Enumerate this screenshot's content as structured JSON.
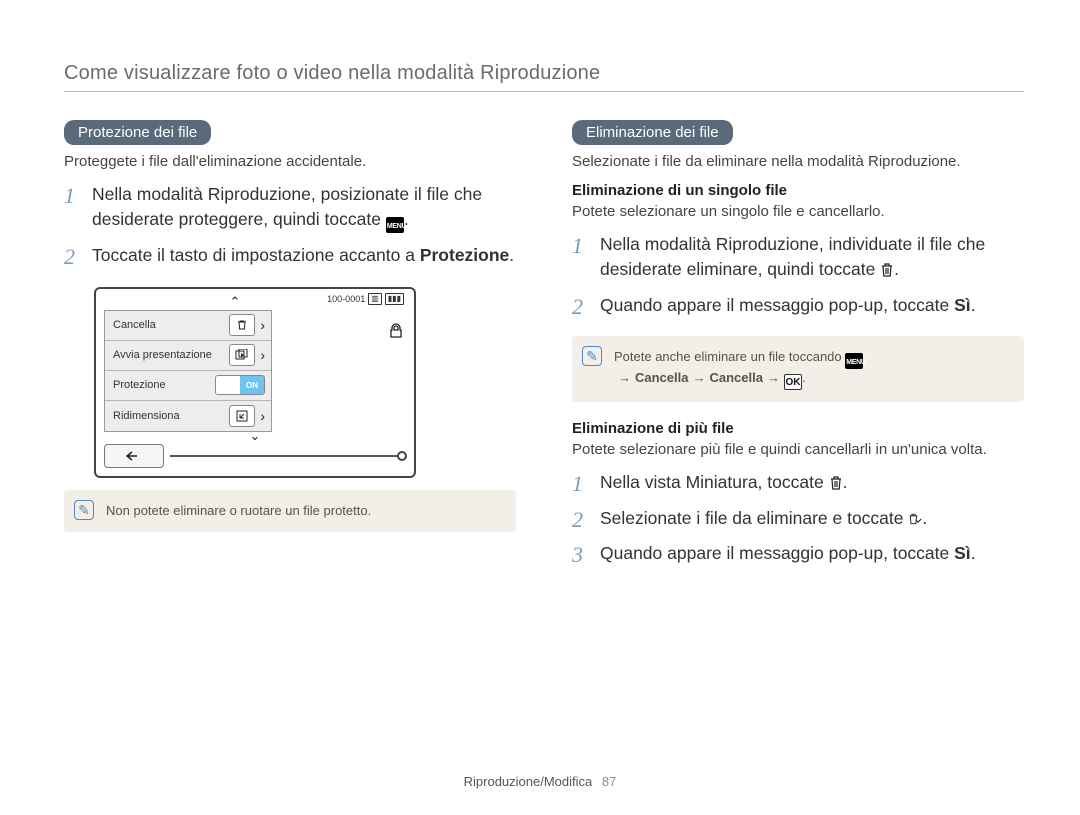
{
  "page_title": "Come visualizzare foto o video nella modalità Riproduzione",
  "footer": {
    "section": "Riproduzione/Modifica",
    "page_number": "87"
  },
  "left": {
    "pill": "Protezione dei file",
    "intro": "Proteggete i file dall'eliminazione accidentale.",
    "steps": [
      {
        "pre": "Nella modalità Riproduzione, posizionate il file che desiderate proteggere, quindi toccate ",
        "post": "."
      },
      {
        "pre": "Toccate il tasto di impostazione accanto a ",
        "bold": "Protezione",
        "post": "."
      }
    ],
    "figure": {
      "counter": "100-0001",
      "lock": "⌐",
      "menu": [
        {
          "label": "Cancella",
          "icon": "trash"
        },
        {
          "label": "Avvia presentazione",
          "icon": "slideshow"
        },
        {
          "label": "Protezione",
          "icon": "toggle",
          "toggle_on": "ON"
        },
        {
          "label": "Ridimensiona",
          "icon": "resize"
        }
      ]
    },
    "note": "Non potete eliminare o ruotare un file protetto."
  },
  "right": {
    "pill": "Eliminazione dei file",
    "intro": "Selezionate i file da eliminare nella modalità Riproduzione.",
    "sub1": {
      "heading": "Eliminazione di un singolo file",
      "desc": "Potete selezionare un singolo file e cancellarlo.",
      "steps": [
        {
          "pre": "Nella modalità Riproduzione, individuate il file che desiderate eliminare, quindi toccate ",
          "post": "."
        },
        {
          "pre": "Quando appare il messaggio pop-up, toccate ",
          "bold": "Sì",
          "post": "."
        }
      ],
      "note": {
        "pre": "Potete anche eliminare un file toccando ",
        "seq": [
          "Cancella",
          "Cancella"
        ],
        "post": "."
      }
    },
    "sub2": {
      "heading": "Eliminazione di più file",
      "desc": "Potete selezionare più file e quindi cancellarli in un'unica volta.",
      "steps": [
        {
          "pre": "Nella vista Miniatura, toccate ",
          "post": "."
        },
        {
          "pre": "Selezionate i file da eliminare e toccate ",
          "post": "."
        },
        {
          "pre": "Quando appare il messaggio pop-up, toccate ",
          "bold": "Sì",
          "post": "."
        }
      ]
    }
  },
  "icons": {
    "menu_label": "MENU",
    "ok_label": "OK"
  }
}
